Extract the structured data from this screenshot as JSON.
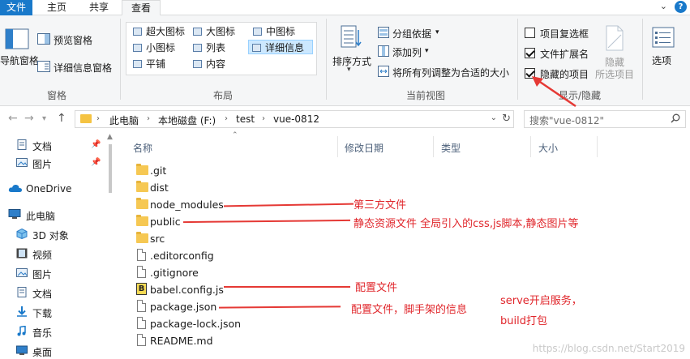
{
  "tabs": [
    "文件",
    "主页",
    "共享",
    "查看"
  ],
  "ribbon": {
    "pane": {
      "nav_pane": "导航窗格",
      "preview_pane": "预览窗格",
      "details_pane": "详细信息窗格",
      "group": "窗格"
    },
    "layout": {
      "items": [
        "超大图标",
        "大图标",
        "中图标",
        "小图标",
        "列表",
        "详细信息",
        "平铺",
        "内容"
      ],
      "selected": "详细信息",
      "group": "布局"
    },
    "current_view": {
      "sort_by": "排序方式",
      "group_by": "分组依据",
      "add_column": "添加列",
      "fit_columns": "将所有列调整为合适的大小",
      "group": "当前视图"
    },
    "show_hide": {
      "checkboxes": [
        {
          "label": "项目复选框",
          "checked": false
        },
        {
          "label": "文件扩展名",
          "checked": true
        },
        {
          "label": "隐藏的项目",
          "checked": true
        }
      ],
      "hide_selected": "隐藏",
      "hide_selected_sub": "所选项目",
      "group": "显示/隐藏"
    },
    "options": "选项"
  },
  "address": {
    "crumbs": [
      "此电脑",
      "本地磁盘 (F:)",
      "test",
      "vue-0812"
    ],
    "search_placeholder": "搜索\"vue-0812\""
  },
  "nav": [
    {
      "label": "文档",
      "pinned": true,
      "icon": "document-icon"
    },
    {
      "label": "图片",
      "pinned": true,
      "icon": "picture-icon"
    },
    {
      "label": "OneDrive",
      "pinned": false,
      "icon": "cloud-icon"
    },
    {
      "label": "此电脑",
      "pinned": false,
      "icon": "computer-icon"
    },
    {
      "label": "3D 对象",
      "pinned": false,
      "icon": "cube-icon"
    },
    {
      "label": "视频",
      "pinned": false,
      "icon": "video-icon"
    },
    {
      "label": "图片",
      "pinned": false,
      "icon": "picture-icon"
    },
    {
      "label": "文档",
      "pinned": false,
      "icon": "document-icon"
    },
    {
      "label": "下载",
      "pinned": false,
      "icon": "download-icon"
    },
    {
      "label": "音乐",
      "pinned": false,
      "icon": "music-icon"
    },
    {
      "label": "桌面",
      "pinned": false,
      "icon": "desktop-icon"
    }
  ],
  "columns": [
    "名称",
    "修改日期",
    "类型",
    "大小"
  ],
  "files": [
    {
      "name": ".git",
      "kind": "folder"
    },
    {
      "name": "dist",
      "kind": "folder"
    },
    {
      "name": "node_modules",
      "kind": "folder"
    },
    {
      "name": "public",
      "kind": "folder"
    },
    {
      "name": "src",
      "kind": "folder"
    },
    {
      "name": ".editorconfig",
      "kind": "file"
    },
    {
      "name": ".gitignore",
      "kind": "file"
    },
    {
      "name": "babel.config.js",
      "kind": "babel"
    },
    {
      "name": "package.json",
      "kind": "file"
    },
    {
      "name": "package-lock.json",
      "kind": "file"
    },
    {
      "name": "README.md",
      "kind": "file"
    }
  ],
  "annotations": {
    "node_modules": "第三方文件",
    "public": "静态资源文件  全局引入的css,js脚本,静态图片等",
    "babel": "配置文件",
    "package": "配置文件，脚手架的信息",
    "serve_line1": "serve开启服务，",
    "serve_line2": "build打包"
  },
  "watermark": "https://blog.csdn.net/Start2019",
  "colors": {
    "accent": "#1979ca",
    "annotation": "#e0262b",
    "folder": "#f6c853"
  }
}
